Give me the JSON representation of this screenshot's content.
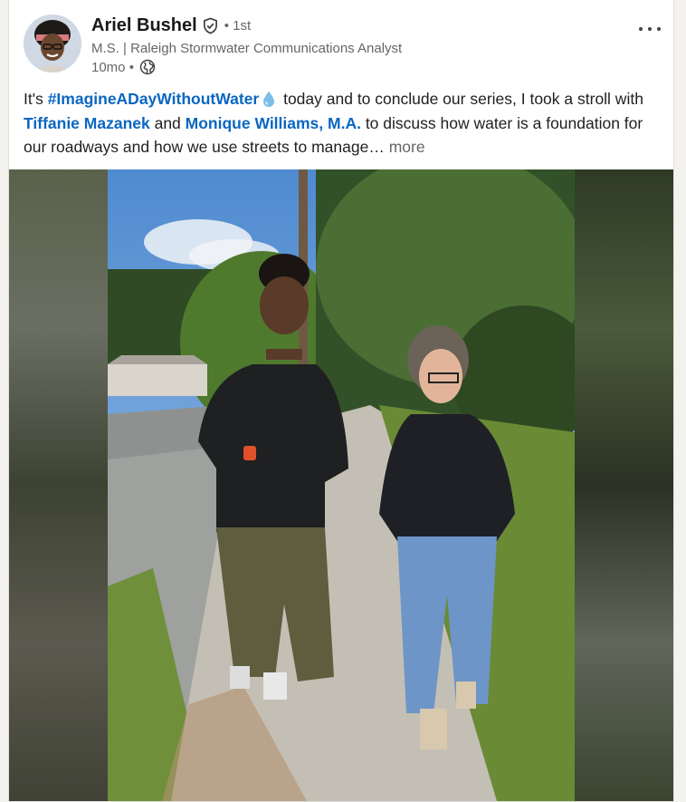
{
  "post": {
    "author": {
      "name": "Ariel Bushel",
      "degree": "• 1st",
      "headline": "M.S. | Raleigh Stormwater Communications Analyst",
      "time": "10mo •",
      "visibility_icon": "globe-icon",
      "verified_icon": "verified-shield-icon"
    },
    "menu_icon": "more-horizontal-icon",
    "text": {
      "p1": "It's ",
      "hashtag": "#ImagineADayWithoutWater",
      "p2": " today and to conclude our series, I took a stroll with ",
      "mention1": "Tiffanie Mazanek",
      "p3": " and ",
      "mention2": "Monique Williams, M.A.",
      "p4": " to discuss how water is a foundation for our roadways and how we use streets to manage…",
      "see_more": " more",
      "emoji_icon": "water-drop-icon"
    },
    "video": {
      "icon": "video-frame"
    }
  },
  "colors": {
    "link": "#0a66c2",
    "muted": "#666666",
    "background": "#f4f2ee"
  }
}
